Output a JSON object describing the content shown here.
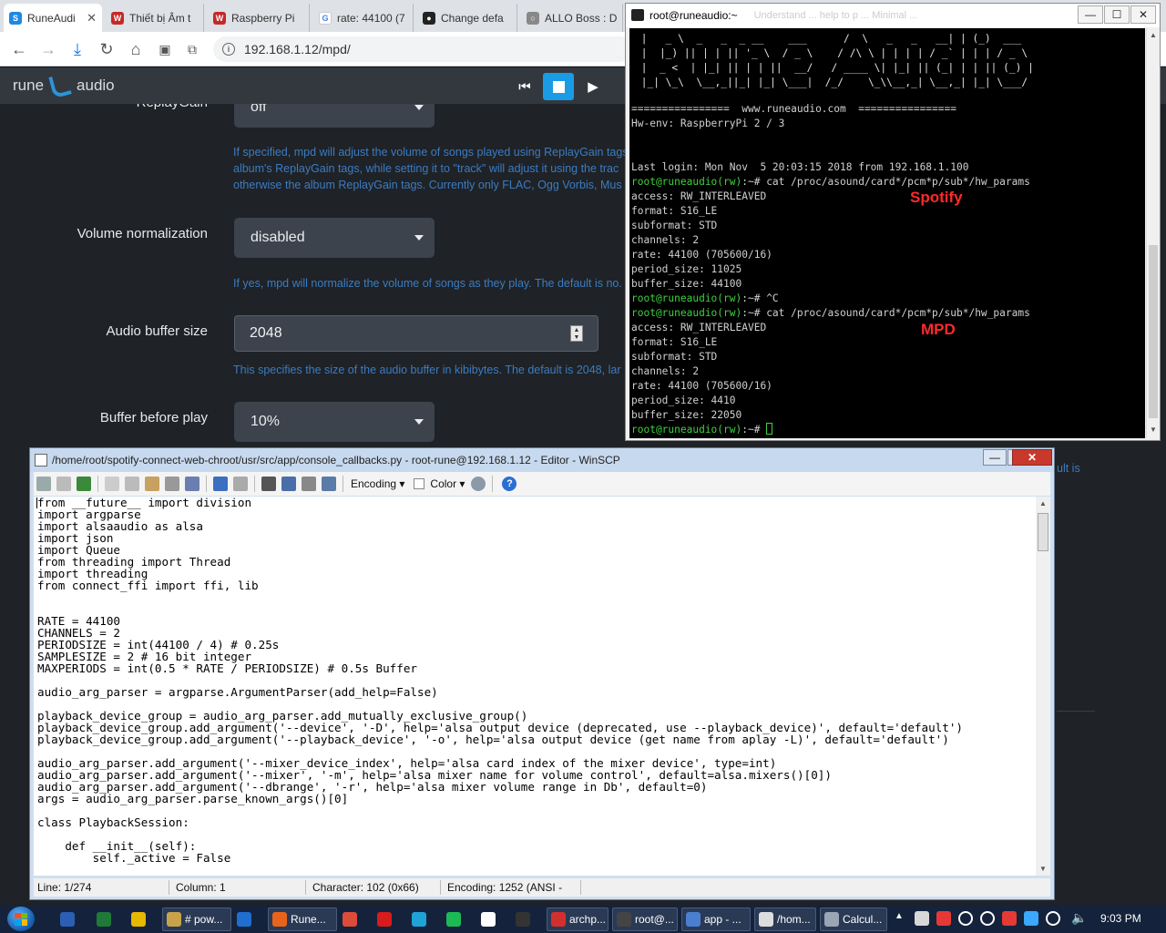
{
  "browser": {
    "tabs": [
      {
        "label": "RuneAudi",
        "color": "#1e88e5",
        "glyph": "S",
        "active": true
      },
      {
        "label": "Thiết bị Âm t",
        "color": "#c62828",
        "glyph": "W"
      },
      {
        "label": "Raspberry Pi",
        "color": "#c62828",
        "glyph": "W"
      },
      {
        "label": "rate: 44100 (7",
        "color": "#ffffff",
        "glyph": "G"
      },
      {
        "label": "Change defa",
        "color": "#222222",
        "glyph": "●"
      },
      {
        "label": "ALLO Boss : D",
        "color": "#888888",
        "glyph": "○"
      }
    ],
    "tab_close": "✕",
    "url": "192.168.1.12/mpd/",
    "info_glyph": "i"
  },
  "rune": {
    "logo_left": "rune",
    "logo_right": "audio",
    "controls": {
      "prev": "⏮",
      "play": "▶"
    },
    "settings": {
      "replaygain": {
        "label": "ReplayGain",
        "value": "off"
      },
      "replaygain_help": [
        "If specified, mpd will adjust the volume of songs played using ReplayGain tags",
        "album's ReplayGain tags, while setting it to \"track\" will adjust it using the trac",
        "otherwise the album ReplayGain tags. Currently only FLAC, Ogg Vorbis, Mus"
      ],
      "volume_norm": {
        "label": "Volume normalization",
        "value": "disabled"
      },
      "volume_norm_help": "If yes, mpd will normalize the volume of songs as they play. The default is no. I",
      "buffer_size": {
        "label": "Audio buffer size",
        "value": "2048"
      },
      "buffer_size_help": "This specifies the size of the audio buffer in kibibytes. The default is 2048, lar",
      "buffer_before": {
        "label": "Buffer before play",
        "value": "10%"
      },
      "right_fragment": "ult is"
    }
  },
  "terminal": {
    "title": "root@runeaudio:~",
    "title_faint": "Understand ...   help to p ...   Minimal ...",
    "win_buttons": {
      "min": "—",
      "max": "☐",
      "close": "✕"
    },
    "art": [
      " |   _ \\  _   _  _ __    ___      /  \\   _   _   __| | (_)  ___",
      " |  |_) || | | || '_ \\  / _ \\    / /\\ \\ | | | | / _` | | | / _ \\",
      " |  _ <  | |_| || | | ||  __/   / ____ \\| |_| || (_| | | || (_) |",
      " |_| \\_\\  \\__,_||_| |_| \\___|  /_/    \\_\\\\__,_| \\__,_| |_| \\___/"
    ],
    "lines": [
      {
        "prompt": "",
        "text": "================  www.runeaudio.com  ================"
      },
      {
        "prompt": "",
        "text": "Hw-env: RaspberryPi 2 / 3"
      },
      {
        "prompt": "",
        "text": ""
      },
      {
        "prompt": "",
        "text": ""
      },
      {
        "prompt": "",
        "text": "Last login: Mon Nov  5 20:03:15 2018 from 192.168.1.100"
      },
      {
        "prompt": "root@runeaudio(rw)",
        "text": ":~# cat /proc/asound/card*/pcm*p/sub*/hw_params"
      },
      {
        "prompt": "",
        "text": "access: RW_INTERLEAVED"
      },
      {
        "prompt": "",
        "text": "format: S16_LE"
      },
      {
        "prompt": "",
        "text": "subformat: STD"
      },
      {
        "prompt": "",
        "text": "channels: 2"
      },
      {
        "prompt": "",
        "text": "rate: 44100 (705600/16)"
      },
      {
        "prompt": "",
        "text": "period_size: 11025"
      },
      {
        "prompt": "",
        "text": "buffer_size: 44100"
      },
      {
        "prompt": "root@runeaudio(rw)",
        "text": ":~# ^C"
      },
      {
        "prompt": "root@runeaudio(rw)",
        "text": ":~# cat /proc/asound/card*/pcm*p/sub*/hw_params"
      },
      {
        "prompt": "",
        "text": "access: RW_INTERLEAVED"
      },
      {
        "prompt": "",
        "text": "format: S16_LE"
      },
      {
        "prompt": "",
        "text": "subformat: STD"
      },
      {
        "prompt": "",
        "text": "channels: 2"
      },
      {
        "prompt": "",
        "text": "rate: 44100 (705600/16)"
      },
      {
        "prompt": "",
        "text": "period_size: 4410"
      },
      {
        "prompt": "",
        "text": "buffer_size: 22050"
      },
      {
        "prompt": "root@runeaudio(rw)",
        "text": ":~# "
      }
    ],
    "note_spotify": "Spotify",
    "note_mpd": "MPD"
  },
  "editor": {
    "title": "/home/root/spotify-connect-web-chroot/usr/src/app/console_callbacks.py - root-rune@192.168.1.12 - Editor - WinSCP",
    "toolbar": {
      "encoding": "Encoding ▾",
      "color": "Color ▾",
      "help": "?"
    },
    "code": [
      "from __future__ import division",
      "import argparse",
      "import alsaaudio as alsa",
      "import json",
      "import Queue",
      "from threading import Thread",
      "import threading",
      "from connect_ffi import ffi, lib",
      "",
      "",
      "RATE = 44100",
      "CHANNELS = 2",
      "PERIODSIZE = int(44100 / 4) # 0.25s",
      "SAMPLESIZE = 2 # 16 bit integer",
      "MAXPERIODS = int(0.5 * RATE / PERIODSIZE) # 0.5s Buffer",
      "",
      "audio_arg_parser = argparse.ArgumentParser(add_help=False)",
      "",
      "playback_device_group = audio_arg_parser.add_mutually_exclusive_group()",
      "playback_device_group.add_argument('--device', '-D', help='alsa output device (deprecated, use --playback_device)', default='default')",
      "playback_device_group.add_argument('--playback_device', '-o', help='alsa output device (get name from aplay -L)', default='default')",
      "",
      "audio_arg_parser.add_argument('--mixer_device_index', help='alsa card index of the mixer device', type=int)",
      "audio_arg_parser.add_argument('--mixer', '-m', help='alsa mixer name for volume control', default=alsa.mixers()[0])",
      "audio_arg_parser.add_argument('--dbrange', '-r', help='alsa mixer volume range in Db', default=0)",
      "args = audio_arg_parser.parse_known_args()[0]",
      "",
      "class PlaybackSession:",
      "",
      "    def __init__(self):",
      "        self._active = False"
    ],
    "status": {
      "line": "Line: 1/274",
      "column": "Column: 1",
      "character": "Character: 102 (0x66)",
      "encoding": "Encoding: 1252  (ANSI -"
    }
  },
  "taskbar": {
    "items": [
      {
        "label": "",
        "color": "#2b5fb3"
      },
      {
        "label": "",
        "color": "#1f7a3a"
      },
      {
        "label": "",
        "color": "#e6b800"
      },
      {
        "label": "# pow...",
        "color": "#c9a24a"
      },
      {
        "label": "",
        "color": "#1e6fcf"
      },
      {
        "label": "Rune...",
        "color": "#e8641b"
      },
      {
        "label": "",
        "color": "#dd4b39"
      },
      {
        "label": "",
        "color": "#d81b1b"
      },
      {
        "label": "",
        "color": "#1fa3d6"
      },
      {
        "label": "",
        "color": "#1db954"
      },
      {
        "label": "",
        "color": "#ffffff"
      },
      {
        "label": "",
        "color": "#333333"
      },
      {
        "label": "archp...",
        "color": "#d32f2f"
      },
      {
        "label": "root@...",
        "color": "#444444"
      },
      {
        "label": "app - ...",
        "color": "#4a7fd0"
      },
      {
        "label": "/hom...",
        "color": "#dddddd"
      },
      {
        "label": "Calcul...",
        "color": "#9aa6b5"
      }
    ],
    "tray_colors": [
      "#d8d8d8",
      "#e53935",
      "#ffffff",
      "#ffffff",
      "#e53935",
      "#3ba7ff",
      "#ffffff",
      "#ffffff"
    ],
    "time": "9:03 PM"
  }
}
